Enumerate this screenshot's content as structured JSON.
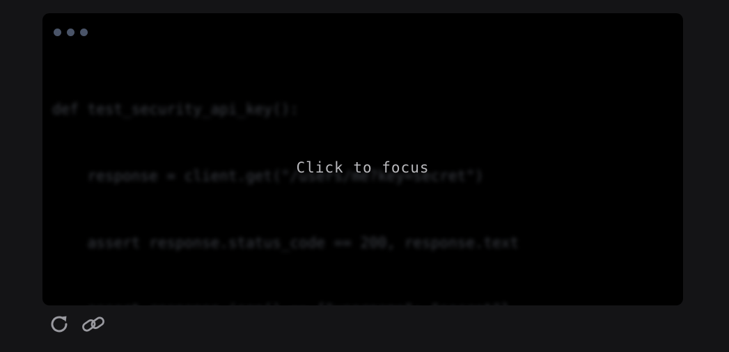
{
  "terminal": {
    "code_lines": [
      "def test_security_api_key():",
      "    response = client.get(\"/users/me?key=secret\")",
      "    assert response.status_code == 200, response.text",
      "    assert response.json() == {\"username\": \"secret\"}"
    ],
    "focus_label": "Click to focus"
  },
  "toolbar": {
    "buttons": [
      {
        "icon": "refresh-icon"
      },
      {
        "icon": "link-icon"
      }
    ]
  },
  "colors": {
    "page_background": "#141416",
    "terminal_background": "#000000",
    "window_dots": "#4a5468",
    "focus_text": "#b9b9bd",
    "icon_color": "#9a9aa0"
  }
}
